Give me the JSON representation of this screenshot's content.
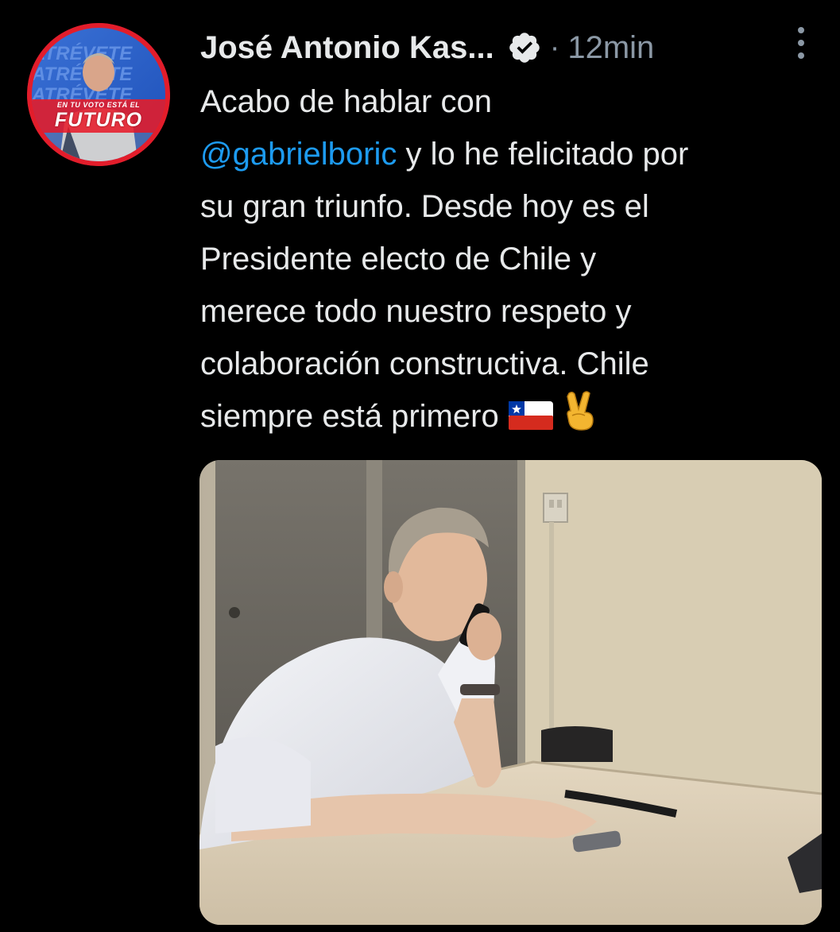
{
  "tweet": {
    "author_name": "José Antonio Kas...",
    "separator": "·",
    "timestamp": "12min",
    "text": {
      "line1": "Acabo de hablar con",
      "mention": "@gabrielboric",
      "line2_rest": " y lo he felicitado por",
      "line3": "su gran triunfo. Desde hoy es el",
      "line4": "Presidente electo de Chile y",
      "line5": "merece todo nuestro respeto y",
      "line6": "colaboración constructiva. Chile",
      "line7": "siempre está primero"
    },
    "emojis": [
      "chile-flag-emoji",
      "victory-hand-emoji"
    ]
  },
  "avatar": {
    "kicker": "EN TU VOTO ESTÁ EL",
    "brand": "FUTURO",
    "background_words": [
      "ATRÉVETE",
      "ATRÉVETE",
      "ATRÉVETE"
    ]
  },
  "icons": {
    "verified": "verified-badge-icon",
    "more": "more-vertical-icon"
  },
  "colors": {
    "background": "#000000",
    "text": "#e7e9ea",
    "secondary": "#8b98a5",
    "mention": "#1d9bf0",
    "avatar_ring": "#e21d2b"
  }
}
